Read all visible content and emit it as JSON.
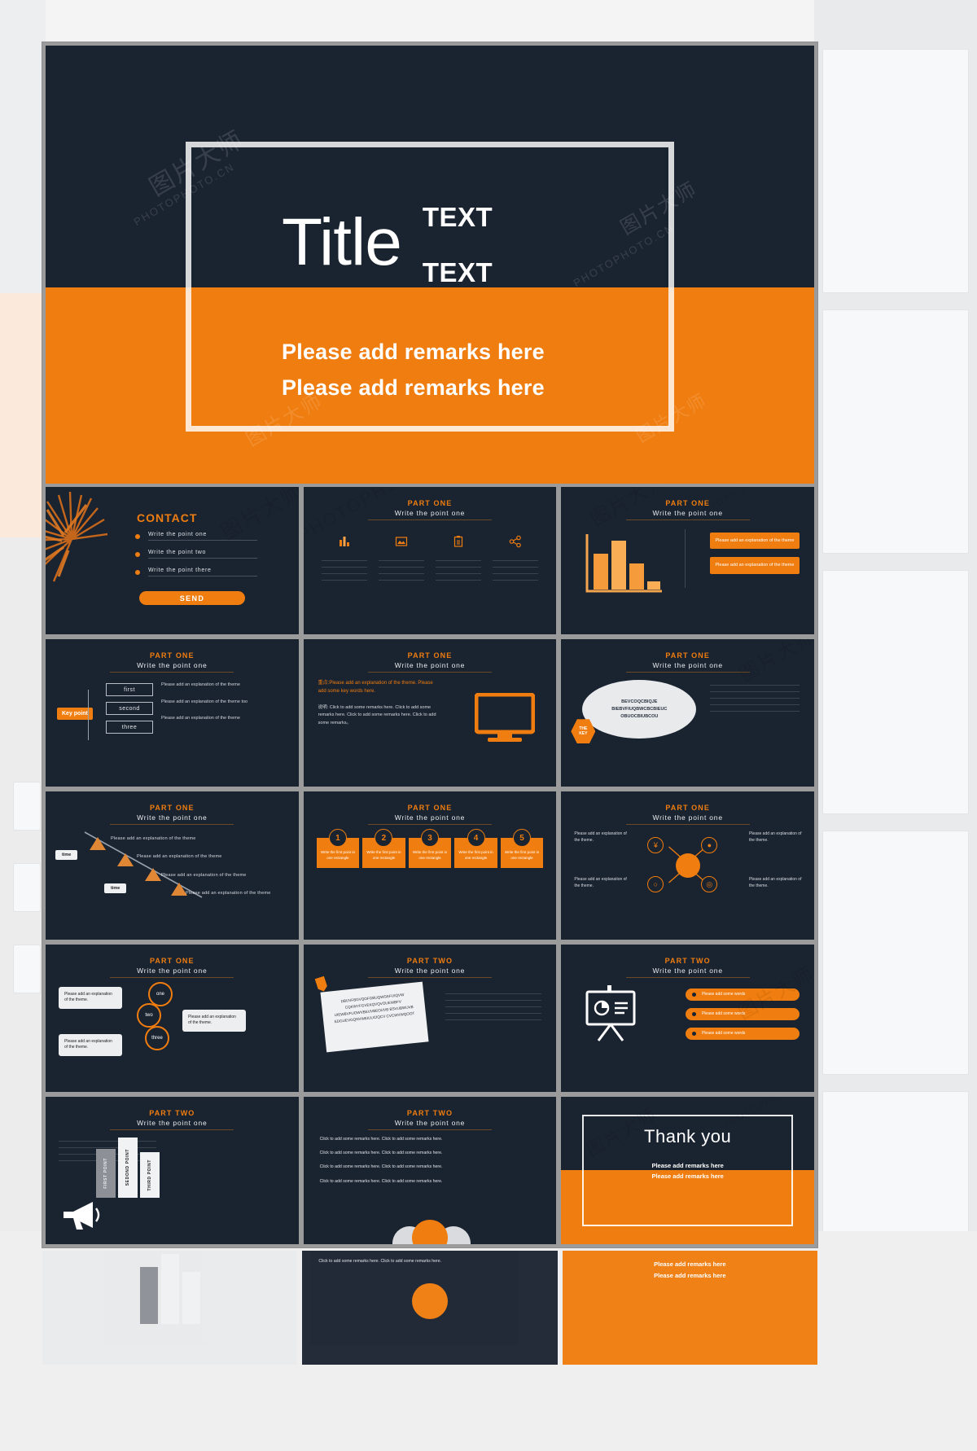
{
  "hero": {
    "title": "Title",
    "text_lines": [
      "TEXT",
      "TEXT"
    ],
    "remarks": [
      "Please add remarks here",
      "Please add remarks here"
    ],
    "colors": {
      "dark": "#1a2330",
      "orange": "#f07d0f",
      "frame": "#ffffff"
    }
  },
  "watermarks": {
    "cn": "图片大师",
    "en": "PHOTOPHOTO.CN"
  },
  "common": {
    "part_one": "PART ONE",
    "part_two": "PART TWO",
    "subtitle": "Write the point  one",
    "explanation": "Please add an explanation of the theme",
    "explanation_too": "Please add an explanation of the theme too",
    "explain_short": "Please add an explanation of the theme.",
    "chip_text": "Please add an explanation of the theme"
  },
  "slides": [
    {
      "id": "contact",
      "title": "CONTACT",
      "items": [
        "Write the point  one",
        "Write the point  two",
        "Write the point  there"
      ],
      "button": "SEND"
    },
    {
      "id": "four-icons",
      "part": "PART ONE",
      "sub": "Write the point  one",
      "icons": [
        "bar-chart-icon",
        "image-icon",
        "clipboard-icon",
        "share-icon"
      ]
    },
    {
      "id": "bar-chart",
      "part": "PART ONE",
      "sub": "Write the point  one",
      "chips": [
        "Please add an explanation of the theme",
        "Please add an explanation of the theme"
      ],
      "bars": [
        62,
        92,
        48,
        18
      ]
    },
    {
      "id": "key-point",
      "part": "PART ONE",
      "sub": "Write the point  one",
      "badge": "Key point",
      "steps": [
        "first",
        "second",
        "three"
      ],
      "descs": [
        "Please add an explanation of the theme",
        "Please add an explanation of the theme too",
        "Please add an explanation of the theme"
      ]
    },
    {
      "id": "monitor",
      "part": "PART ONE",
      "sub": "Write the point  one",
      "highlight": "重点:Please add an explanation of the theme. Please add some key words here.",
      "body": "说明: Click to add some remarks here. Click to add some remarks here. Click to add some remarks here. Click to add some remarks。"
    },
    {
      "id": "oval",
      "part": "PART ONE",
      "sub": "Write the point  one",
      "oval_text": "BEVCOQCBIQJE BIEBVFIUQBWCBCBIEUC OBUOCBIUBCOU",
      "key_badge": [
        "THE",
        "KEY"
      ]
    },
    {
      "id": "timeline",
      "part": "PART ONE",
      "sub": "Write the point  one",
      "tags": [
        "time",
        "time"
      ],
      "items": [
        "Please add an explanation of the theme",
        "Please add an explanation of the theme",
        "Please add an explanation of the theme",
        "Please add an explanation of the theme"
      ]
    },
    {
      "id": "numbered",
      "part": "PART ONE",
      "sub": "Write the point  one",
      "numbers": [
        "1",
        "2",
        "3",
        "4",
        "5"
      ],
      "card_text": "Write the first point in one rectangle"
    },
    {
      "id": "hub",
      "part": "PART ONE",
      "sub": "Write the point  one",
      "node_icons": [
        "yen-icon",
        "user-icon",
        "chat-icon",
        "globe-icon"
      ],
      "texts": [
        "Please add an explanation of the theme.",
        "Please add an explanation of the theme.",
        "Please add an explanation of the theme.",
        "Please add an explanation of the theme."
      ]
    },
    {
      "id": "bubbles",
      "part": "PART ONE",
      "sub": "Write the point  one",
      "rings": [
        "one",
        "two",
        "three"
      ],
      "bubbles": [
        "Please add an explanation of the theme.",
        "Please add an explanation of the theme.",
        "Please add an explanation of the theme."
      ]
    },
    {
      "id": "note-card",
      "part": "PART TWO",
      "sub": "Write the point  one",
      "note_text": "DBUVFBGVQOFGBUQWGEFUIQVW CQKWYFGVEKQVQVOUEWBFV UIEWBVFUOWVBEUVBEOUVB BSVUBWUVB EDGUEVGQNVWEIUUCIQCV CVCWVWQOOT"
    },
    {
      "id": "presentation-board",
      "part": "PART TWO",
      "sub": "Write the point  one",
      "pills": [
        "Please add some words",
        "Please add some words",
        "Please add some words"
      ]
    },
    {
      "id": "megaphone",
      "part": "PART TWO",
      "sub": "Write the point  one",
      "bar_labels": [
        "FIRST POINT",
        "SEDOND POINT",
        "THIRD POINT"
      ]
    },
    {
      "id": "remarks-list",
      "part": "PART TWO",
      "sub": "Write the point  one",
      "lines": [
        "Click to add some remarks here. Click to add some remarks here.",
        "Click to add some remarks here. Click to add some remarks here.",
        "Click to add some remarks here. Click to add some remarks here.",
        "Click to add some remarks here. Click to add some remarks here."
      ]
    },
    {
      "id": "thank-you",
      "title": "Thank you",
      "remarks": [
        "Please add remarks here",
        "Please add remarks here"
      ]
    }
  ],
  "peek": {
    "line1": "Click to add some remarks here. Click to add some remarks here.",
    "line2": "Please add remarks here",
    "line3": "Please add remarks here"
  }
}
